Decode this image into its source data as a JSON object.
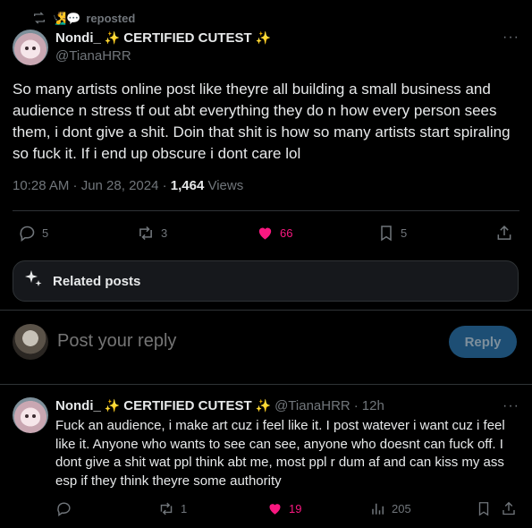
{
  "repost": {
    "emoji": "🧏‍♂️💬",
    "label": "reposted"
  },
  "post": {
    "display_name": "Nondi_",
    "flair": "CERTIFIED CUTEST",
    "handle": "@TianaHRR",
    "text": "So many artists online post like theyre all building a small business and audience n stress tf out abt everything they do n how every person sees them, i dont give a shit. Doin that shit is how so many artists start spiraling so fuck it. If i end up obscure i dont care lol",
    "time": "10:28 AM · Jun 28, 2024 · ",
    "views_count": "1,464",
    "views_label": " Views",
    "replies": "5",
    "reposts": "3",
    "likes": "66",
    "bookmarks": "5"
  },
  "related": {
    "label": "Related posts"
  },
  "reply_composer": {
    "placeholder": "Post your reply",
    "button": "Reply"
  },
  "reply_post": {
    "display_name": "Nondi_",
    "flair": "CERTIFIED CUTEST",
    "handle": "@TianaHRR",
    "dot": "·",
    "time": "12h",
    "text": "Fuck an audience, i make art cuz i feel like it. I post watever i want cuz i feel like it. Anyone who wants to see can see, anyone who doesnt can fuck off. I dont give a shit wat ppl think abt me, most ppl r dum af and can kiss my ass esp if they think theyre some authority",
    "reposts": "1",
    "likes": "19",
    "views": "205"
  },
  "colors": {
    "accent_like": "#f91880",
    "muted": "#71767b",
    "reply_button": "#1d4e74"
  },
  "icons": [
    "repost-icon",
    "more-icon",
    "reply-icon",
    "retweet-icon",
    "heart-icon",
    "bookmark-icon",
    "share-icon",
    "sparkle-icon",
    "views-icon"
  ]
}
